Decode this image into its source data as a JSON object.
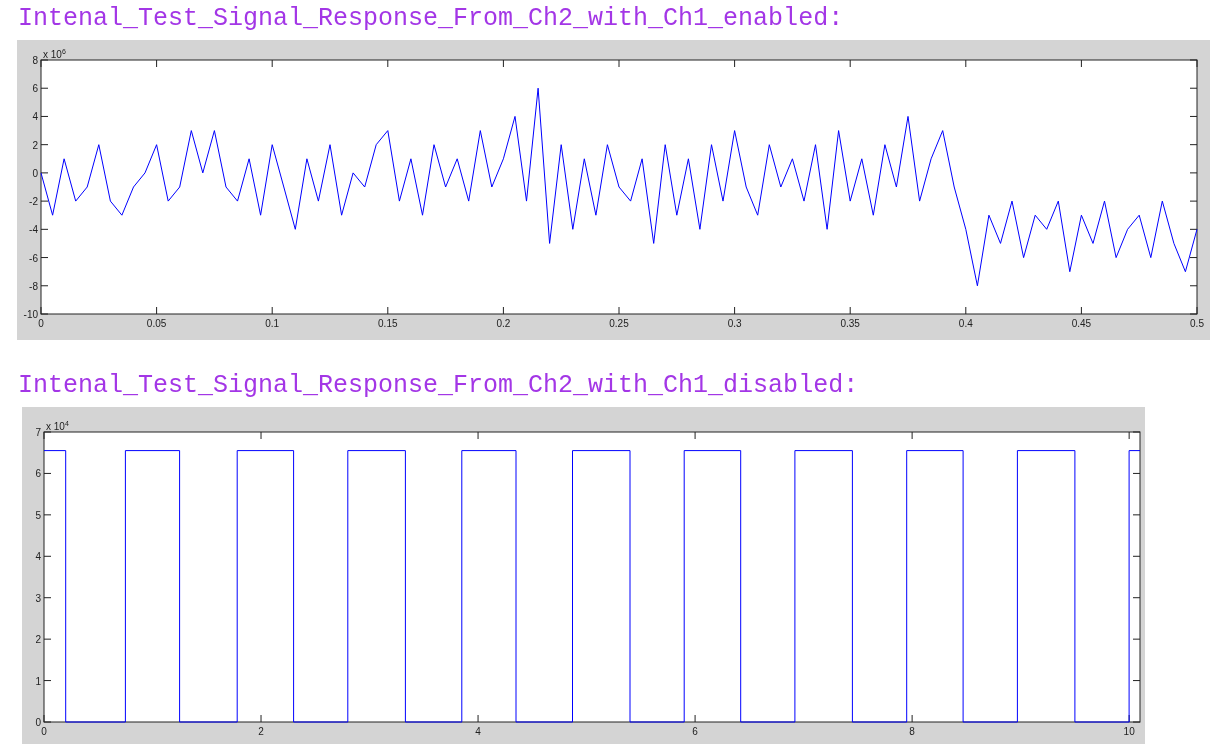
{
  "sections": [
    {
      "title": "Intenal_Test_Signal_Response_From_Ch2_with_Ch1_enabled:",
      "chart_data": {
        "type": "line",
        "xlim": [
          0,
          0.5
        ],
        "ylim": [
          -10,
          8
        ],
        "xticks": [
          0,
          0.05,
          0.1,
          0.15,
          0.2,
          0.25,
          0.3,
          0.35,
          0.4,
          0.45,
          0.5
        ],
        "yticks": [
          -10,
          -8,
          -6,
          -4,
          -2,
          0,
          2,
          4,
          6,
          8
        ],
        "annotations": [
          "x 10$^{6}$"
        ],
        "x": [
          0,
          0.005,
          0.01,
          0.015,
          0.02,
          0.025,
          0.03,
          0.035,
          0.04,
          0.045,
          0.05,
          0.055,
          0.06,
          0.065,
          0.07,
          0.075,
          0.08,
          0.085,
          0.09,
          0.095,
          0.1,
          0.105,
          0.11,
          0.115,
          0.12,
          0.125,
          0.13,
          0.135,
          0.14,
          0.145,
          0.15,
          0.155,
          0.16,
          0.165,
          0.17,
          0.175,
          0.18,
          0.185,
          0.19,
          0.195,
          0.2,
          0.205,
          0.21,
          0.215,
          0.22,
          0.225,
          0.23,
          0.235,
          0.24,
          0.245,
          0.25,
          0.255,
          0.26,
          0.265,
          0.27,
          0.275,
          0.28,
          0.285,
          0.29,
          0.295,
          0.3,
          0.305,
          0.31,
          0.315,
          0.32,
          0.325,
          0.33,
          0.335,
          0.34,
          0.345,
          0.35,
          0.355,
          0.36,
          0.365,
          0.37,
          0.375,
          0.38,
          0.385,
          0.39,
          0.395,
          0.4,
          0.405,
          0.41,
          0.415,
          0.42,
          0.425,
          0.43,
          0.435,
          0.44,
          0.445,
          0.45,
          0.455,
          0.46,
          0.465,
          0.47,
          0.475,
          0.48,
          0.485,
          0.49,
          0.495,
          0.5
        ],
        "series": [
          {
            "color": "#0000ff",
            "values": [
              0,
              -3,
              1,
              -2,
              -1,
              2,
              -2,
              -3,
              -1,
              0,
              2,
              -2,
              -1,
              3,
              0,
              3,
              -1,
              -2,
              1,
              -3,
              2,
              -1,
              -4,
              1,
              -2,
              2,
              -3,
              0,
              -1,
              2,
              3,
              -2,
              1,
              -3,
              2,
              -1,
              1,
              -2,
              3,
              -1,
              1,
              4,
              -2,
              6,
              -5,
              2,
              -4,
              1,
              -3,
              2,
              -1,
              -2,
              1,
              -5,
              2,
              -3,
              1,
              -4,
              2,
              -2,
              3,
              -1,
              -3,
              2,
              -1,
              1,
              -2,
              2,
              -4,
              3,
              -2,
              1,
              -3,
              2,
              -1,
              4,
              -2,
              1,
              3,
              -1,
              -4,
              -8,
              -3,
              -5,
              -2,
              -6,
              -3,
              -4,
              -2,
              -7,
              -3,
              -5,
              -2,
              -6,
              -4,
              -3,
              -6,
              -2,
              -5,
              -7,
              -4
            ]
          }
        ]
      }
    },
    {
      "title": "Intenal_Test_Signal_Response_From_Ch2_with_Ch1_disabled:",
      "chart_data": {
        "type": "line",
        "xlim": [
          0,
          10.1
        ],
        "ylim": [
          0,
          7
        ],
        "xticks": [
          0,
          2,
          4,
          6,
          8,
          10
        ],
        "yticks": [
          0,
          1,
          2,
          3,
          4,
          5,
          6,
          7
        ],
        "annotations": [
          "x 10$^{4}$"
        ],
        "x": [
          0,
          0.2,
          0.2,
          0.75,
          0.75,
          1.25,
          1.25,
          1.78,
          1.78,
          2.3,
          2.3,
          2.8,
          2.8,
          3.33,
          3.33,
          3.85,
          3.85,
          4.35,
          4.35,
          4.87,
          4.87,
          5.4,
          5.4,
          5.9,
          5.9,
          6.42,
          6.42,
          6.92,
          6.92,
          7.45,
          7.45,
          7.95,
          7.95,
          8.47,
          8.47,
          8.97,
          8.97,
          9.5,
          9.5,
          10,
          10,
          10.1
        ],
        "series": [
          {
            "color": "#0000ff",
            "values": [
              6.55,
              6.55,
              0,
              0,
              6.55,
              6.55,
              0,
              0,
              6.55,
              6.55,
              0,
              0,
              6.55,
              6.55,
              0,
              0,
              6.55,
              6.55,
              0,
              0,
              6.55,
              6.55,
              0,
              0,
              6.55,
              6.55,
              0,
              0,
              6.55,
              6.55,
              0,
              0,
              6.55,
              6.55,
              0,
              0,
              6.55,
              6.55,
              0,
              0,
              6.55,
              6.55
            ]
          }
        ]
      }
    }
  ]
}
